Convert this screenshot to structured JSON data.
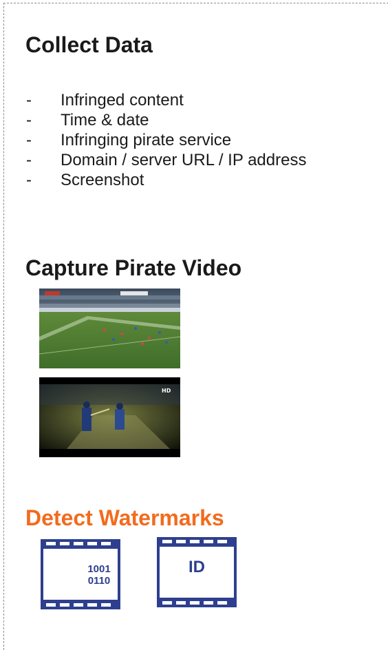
{
  "collect": {
    "title": "Collect Data",
    "items": [
      {
        "dash": "-",
        "label": "Infringed content"
      },
      {
        "dash": "-",
        "label": "Time & date"
      },
      {
        "dash": "-",
        "label": "Infringing pirate service"
      },
      {
        "dash": "-",
        "label": "Domain / server URL / IP address"
      },
      {
        "dash": "-",
        "label": "Screenshot"
      }
    ]
  },
  "capture": {
    "title": "Capture Pirate Video",
    "thumbnails": [
      "soccer-match-frame",
      "cricket-match-frame"
    ]
  },
  "detect": {
    "title": "Detect Watermarks",
    "binary_line1": "1001",
    "binary_line2": "0110",
    "id_label": "ID"
  },
  "colors": {
    "heading": "#1a1a1a",
    "accent": "#f26b1d",
    "film": "#2e3f8f"
  }
}
